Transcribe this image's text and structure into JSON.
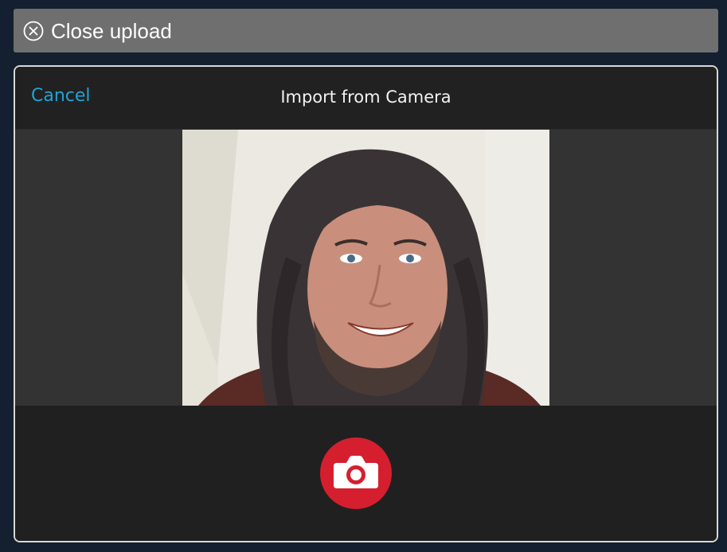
{
  "close_bar": {
    "label": "Close upload",
    "icon": "close-circle-icon"
  },
  "modal": {
    "cancel_label": "Cancel",
    "title": "Import from Camera",
    "shutter_icon": "camera-icon"
  },
  "colors": {
    "accent_link": "#1fa3d8",
    "shutter": "#d51f2f",
    "background": "#14202f"
  }
}
